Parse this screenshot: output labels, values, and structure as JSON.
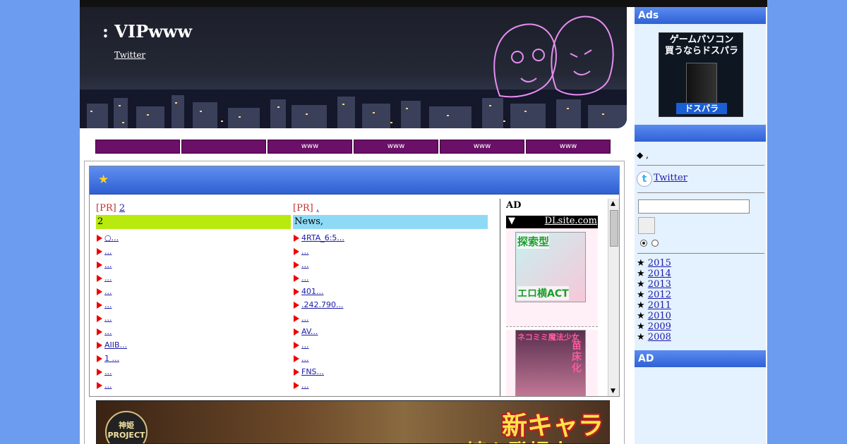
{
  "header": {
    "title": ": VIPwww",
    "twitter_link": "Twitter"
  },
  "nav": [
    {
      "label": ""
    },
    {
      "label": ""
    },
    {
      "label": "www"
    },
    {
      "label": "www"
    },
    {
      "label": "www"
    },
    {
      "label": "www"
    }
  ],
  "main": {
    "star": "★",
    "left": {
      "pr_prefix": "[PR]",
      "pr_link": "2",
      "head": "2",
      "head_color": "#b8ea10",
      "items": [
        "○...",
        "...",
        "...",
        "...",
        "...",
        "...",
        "...",
        "...",
        "AIIB...",
        "1 ...",
        "...",
        "..."
      ]
    },
    "right": {
      "pr_prefix": "[PR]",
      "pr_link": ",",
      "head": "News,",
      "head_color": "#8edaf5",
      "items": [
        "4RTA_6:5...",
        "...",
        "...",
        "...",
        "401...",
        ".242.790...",
        "...",
        "AV...",
        "...",
        "...",
        "FNS...",
        "..."
      ]
    },
    "ad_col": {
      "title": "AD",
      "bar_arrow": "▼",
      "bar_link": "DLsite.com",
      "ad1_top": "探索型",
      "ad1_bottom": "エロ横ACT",
      "ad2_top": "ネコミミ魔法少女",
      "ad2_side": "苗床化"
    },
    "banner": {
      "logo": "神姫 PROJECT",
      "headline": "新キャラ",
      "sub": "続々登場中!"
    }
  },
  "sidebar": {
    "ads_title": "Ads",
    "ads_image": {
      "line1": "ゲームパソコン",
      "line2": "買うならドスパラ",
      "brand": "ドスパラ"
    },
    "section2_title": "",
    "diamond": "◆ ,",
    "twitter": "Twitter",
    "archive_star": "★",
    "archive": [
      "2015",
      "2014",
      "2013",
      "2012",
      "2011",
      "2010",
      "2009",
      "2008"
    ],
    "ad_title": "AD"
  }
}
